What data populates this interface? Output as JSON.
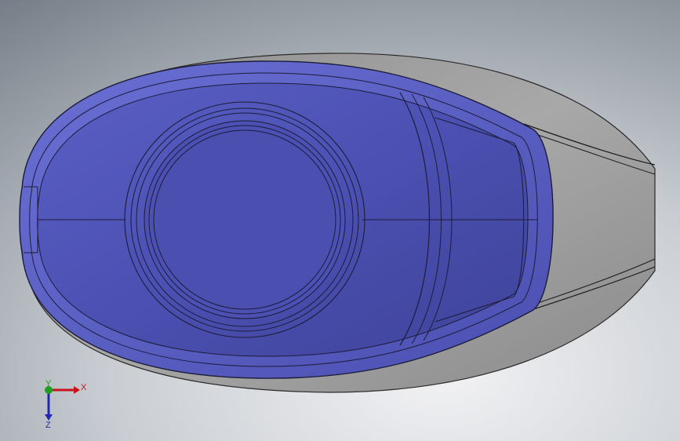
{
  "viewport": {
    "background_top": "#8c96a0",
    "background_bottom": "#e8e8ea"
  },
  "part": {
    "shell_color": "#9a9a9a",
    "selected_face_color": "#4a4fb0",
    "edge_color": "#1c1c3a"
  },
  "triad": {
    "x_label": "X",
    "y_label": "Y",
    "z_label": "Z",
    "x_color": "#c8141e",
    "y_color": "#1ea01e",
    "z_color": "#1e28b4"
  }
}
